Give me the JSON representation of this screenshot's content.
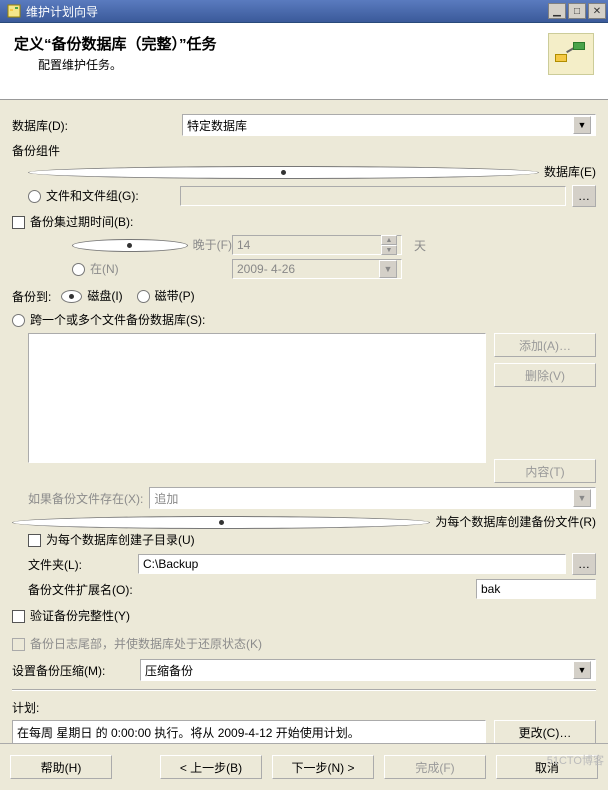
{
  "window": {
    "title": "维护计划向导"
  },
  "header": {
    "title": "定义“备份数据库（完整）”任务",
    "subtitle": "配置维护任务。"
  },
  "db": {
    "label": "数据库(D):",
    "value": "特定数据库"
  },
  "backup_component": {
    "group": "备份组件",
    "opt_db": "数据库(E)",
    "opt_fg": "文件和文件组(G):"
  },
  "expire": {
    "group": "备份集过期时间(B):",
    "later": "晚于(F)",
    "later_val": "14",
    "later_unit": "天",
    "on": "在(N)",
    "on_val": "2009- 4-26"
  },
  "backup_to": {
    "label": "备份到:",
    "disk": "磁盘(I)",
    "tape": "磁带(P)"
  },
  "files": {
    "mode_span": "跨一个或多个文件备份数据库(S):",
    "add": "添加(A)…",
    "remove": "删除(V)",
    "contents": "内容(T)",
    "exists_label": "如果备份文件存在(X):",
    "exists_val": "追加",
    "mode_each": "为每个数据库创建备份文件(R)",
    "subdir": "为每个数据库创建子目录(U)",
    "folder_label": "文件夹(L):",
    "folder_val": "C:\\Backup",
    "ext_label": "备份文件扩展名(O):",
    "ext_val": "bak"
  },
  "verify": {
    "label": "验证备份完整性(Y)"
  },
  "tail": {
    "label": "备份日志尾部，并使数据库处于还原状态(K)"
  },
  "compress": {
    "label": "设置备份压缩(M):",
    "value": "压缩备份"
  },
  "schedule": {
    "label": "计划:",
    "text": "在每周 星期日 的 0:00:00 执行。将从 2009-4-12 开始使用计划。",
    "change": "更改(C)…"
  },
  "footer": {
    "help": "帮助(H)",
    "back": "< 上一步(B)",
    "next": "下一步(N) >",
    "finish": "完成(F)",
    "cancel": "取消"
  },
  "watermark": "51CTO博客"
}
